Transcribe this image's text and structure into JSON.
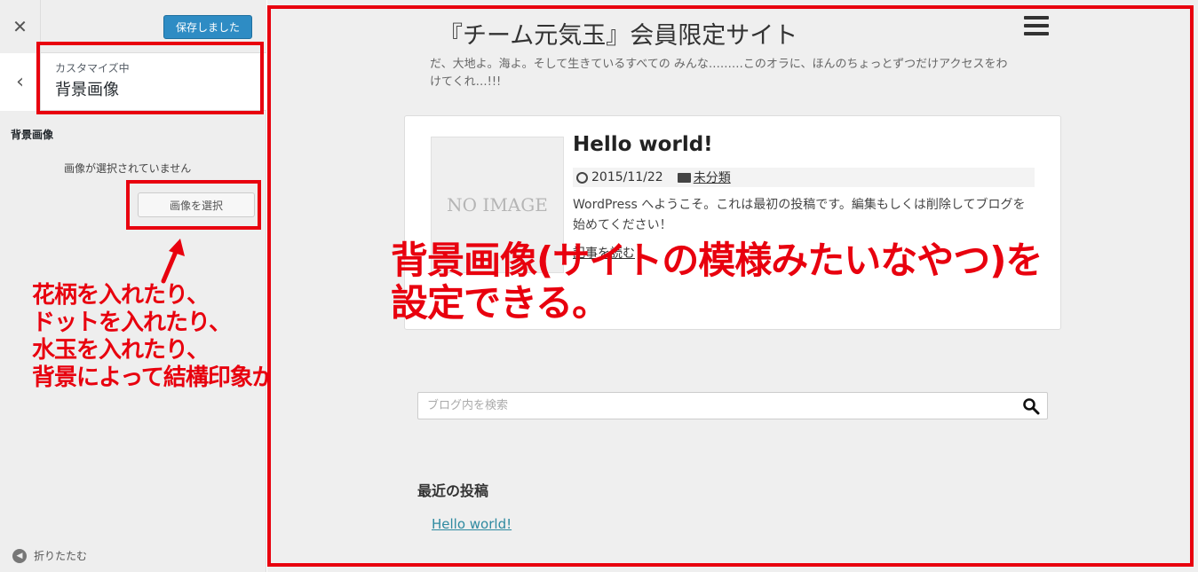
{
  "sidebar": {
    "close_label": "✕",
    "save_label": "保存しました",
    "back_label": "‹",
    "customizing_label": "カスタマイズ中",
    "section_title": "背景画像",
    "control_title": "背景画像",
    "no_image_text": "画像が選択されていません",
    "select_button_label": "画像を選択",
    "collapse_label": "折りたたむ",
    "icons": {
      "close": "close-icon",
      "back": "chevron-left-icon",
      "collapse": "collapse-circle-icon"
    }
  },
  "annotations": {
    "left_lines": [
      "花柄を入れたり、",
      "ドットを入れたり、",
      "水玉を入れたり、",
      "背景によって結構印象が変わる"
    ],
    "right_lines": [
      "背景画像(サイトの模様みたいなやつ)を",
      "設定できる。"
    ],
    "color": "#e8000e"
  },
  "preview": {
    "site_title": "『チーム元気玉』会員限定サイト",
    "tagline": "だ、大地よ。海よ。そして生きているすべての みんな………このオラに、ほんのちょっとずつだけアクセスをわけてくれ…!!!",
    "post": {
      "thumbnail_text": "NO IMAGE",
      "title": "Hello world!",
      "date": "2015/11/22",
      "category": "未分類",
      "excerpt": "WordPress へようこそ。これは最初の投稿です。編集もしくは削除してブログを始めてください！",
      "read_more": "記事を読む"
    },
    "search": {
      "placeholder": "ブログ内を検索",
      "value": ""
    },
    "recent_posts": {
      "title": "最近の投稿",
      "items": [
        "Hello world!"
      ]
    }
  },
  "colors": {
    "accent": "#2e8cc4",
    "highlight": "#e8000e",
    "link": "#2e8aa0"
  }
}
